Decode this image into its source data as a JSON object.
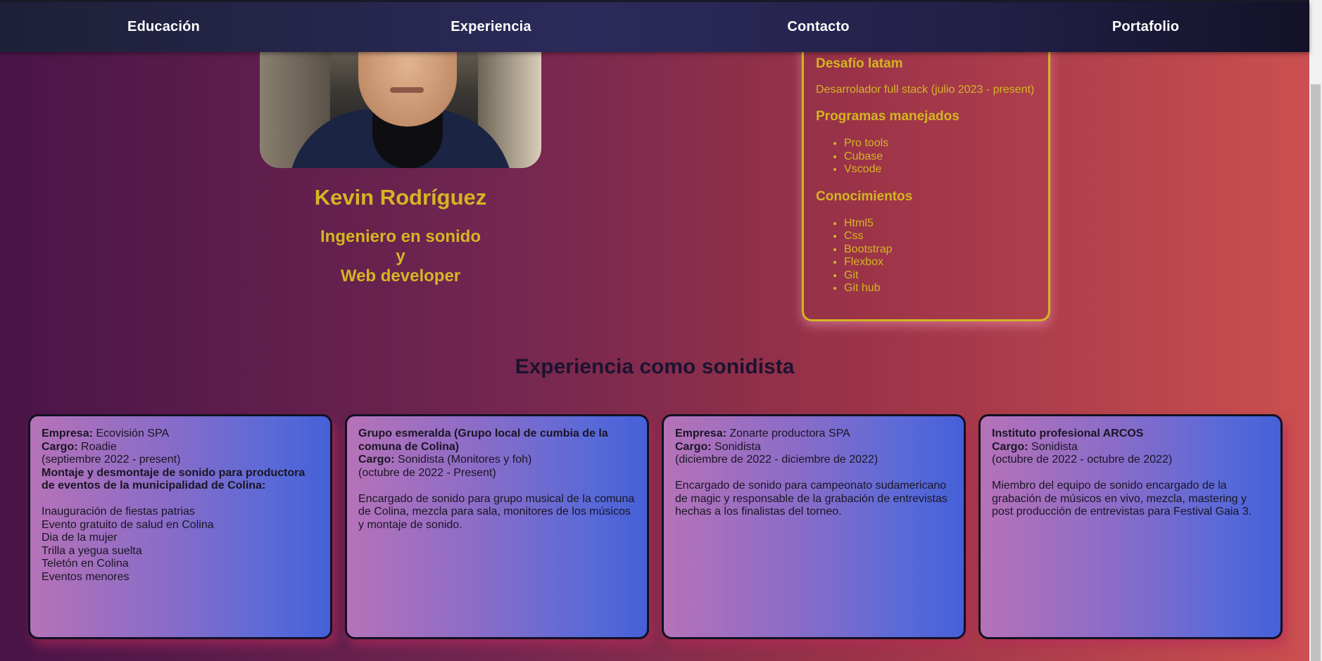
{
  "nav": {
    "items": [
      "Educación",
      "Experiencia",
      "Contacto",
      "Portafolio"
    ]
  },
  "hero": {
    "name": "Kevin Rodríguez",
    "subtitle_line1": "Ingeniero en sonido",
    "subtitle_line2": "y",
    "subtitle_line3": "Web developer"
  },
  "info": {
    "company": "Desafío latam",
    "job": "Desarrolador full stack (julio 2023 - present)",
    "programs_title": "Programas manejados",
    "programs": [
      "Pro tools",
      "Cubase",
      "Vscode"
    ],
    "knowledge_title": "Conocimientos",
    "knowledge": [
      "Html5",
      "Css",
      "Bootstrap",
      "Flexbox",
      "Git",
      "Git hub"
    ]
  },
  "experience": {
    "title": "Experiencia como sonidista",
    "cards": [
      {
        "company_label": "Empresa:",
        "company": "Ecovisión SPA",
        "role_label": "Cargo:",
        "role": "Roadie",
        "dates": "(septiembre 2022 - present)",
        "heading": "Montaje y desmontaje de sonido para productora de eventos de la municipalidad de Colina:",
        "events": [
          "Inauguración de fiestas patrias",
          "Evento gratuito de salud en Colina",
          "Dia de la mujer",
          "Trilla a yegua suelta",
          "Teletón en Colina",
          "Eventos menores"
        ]
      },
      {
        "company": "Grupo esmeralda (Grupo local de cumbia de la comuna de Colina)",
        "role_label": "Cargo:",
        "role": "Sonidista (Monitores y foh)",
        "dates": "(octubre de 2022 - Present)",
        "description": "Encargado de sonido para grupo musical de la comuna de Colina, mezcla para sala, monitores de los músicos y montaje de sonido."
      },
      {
        "company_label": "Empresa:",
        "company": "Zonarte productora SPA",
        "role_label": "Cargo:",
        "role": "Sonidista",
        "dates": "(diciembre de 2022 - diciembre de 2022)",
        "description": "Encargado de sonido para campeonato sudamericano de magic y responsable de la grabación de entrevistas hechas a los finalistas del torneo."
      },
      {
        "company": "Instituto profesional ARCOS",
        "role_label": "Cargo:",
        "role": "Sonidista",
        "dates": "(octubre de 2022 - octubre de 2022)",
        "description": "Miembro del equipo de sonido encargado de la grabación de músicos en vivo, mezcla, mastering y post producción de entrevistas para Festival Gaia 3."
      }
    ]
  },
  "colors": {
    "accent_gold": "#d4b523",
    "nav_bg": "#2c2a5a",
    "card_gradient_start": "#b672b8",
    "card_gradient_end": "#4560d8"
  }
}
